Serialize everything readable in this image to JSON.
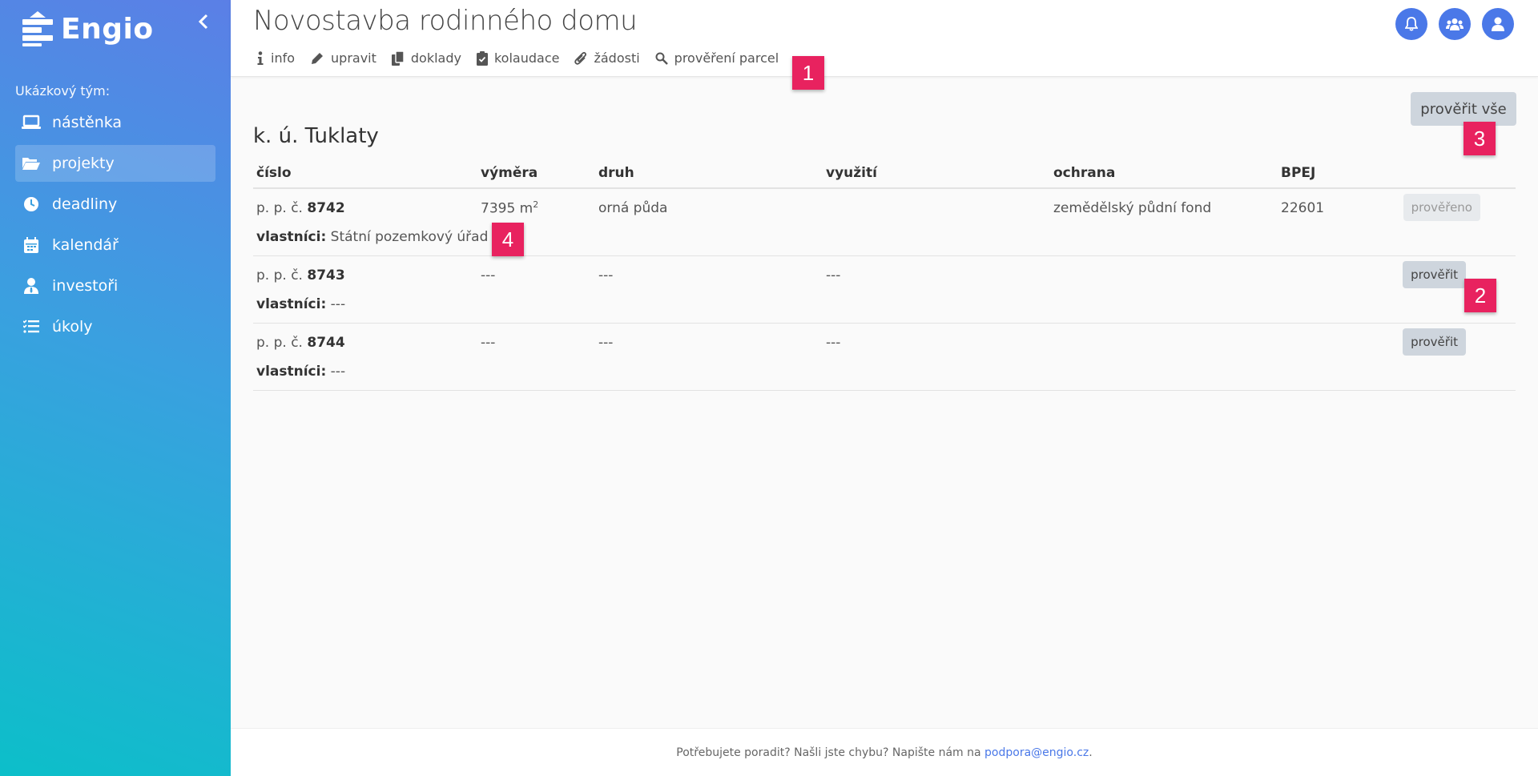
{
  "sidebar": {
    "logo_text": "Engio",
    "team_label": "Ukázkový tým:",
    "items": [
      {
        "label": "nástěnka",
        "icon": "laptop-icon"
      },
      {
        "label": "projekty",
        "icon": "folder-open-icon",
        "active": true
      },
      {
        "label": "deadliny",
        "icon": "clock-icon"
      },
      {
        "label": "kalendář",
        "icon": "calendar-icon"
      },
      {
        "label": "investoři",
        "icon": "user-tie-icon"
      },
      {
        "label": "úkoly",
        "icon": "tasks-icon"
      }
    ]
  },
  "header": {
    "title": "Novostavba rodinného domu",
    "tabs": [
      {
        "label": "info",
        "icon": "info-icon"
      },
      {
        "label": "upravit",
        "icon": "pencil-icon"
      },
      {
        "label": "doklady",
        "icon": "copy-icon"
      },
      {
        "label": "kolaudace",
        "icon": "clipboard-check-icon"
      },
      {
        "label": "žádosti",
        "icon": "paperclip-icon"
      },
      {
        "label": "prověření parcel",
        "icon": "search-icon"
      }
    ],
    "buttons": [
      "bell-icon",
      "users-icon",
      "user-icon"
    ]
  },
  "main": {
    "verify_all": "prověřit vše",
    "section_title": "k. ú. Tuklaty",
    "columns": [
      "číslo",
      "výměra",
      "druh",
      "využití",
      "ochrana",
      "BPEJ"
    ],
    "owners_label": "vlastníci:",
    "parcel_prefix": "p. p. č.",
    "rows": [
      {
        "number": "8742",
        "area": "7395 m",
        "area_sup": "2",
        "type": "orná půda",
        "use": "",
        "protection": "zemědělský půdní fond",
        "bpej": "22601",
        "owners": "Státní pozemkový úřad",
        "button": "prověřeno",
        "disabled": true
      },
      {
        "number": "8743",
        "area": "---",
        "area_sup": "",
        "type": "---",
        "use": "---",
        "protection": "",
        "bpej": "",
        "owners": "---",
        "button": "prověřit",
        "disabled": false
      },
      {
        "number": "8744",
        "area": "---",
        "area_sup": "",
        "type": "---",
        "use": "---",
        "protection": "",
        "bpej": "",
        "owners": "---",
        "button": "prověřit",
        "disabled": false
      }
    ]
  },
  "footer": {
    "text": "Potřebujete poradit? Našli jste chybu? Napište nám na ",
    "email": "podpora@engio.cz",
    "end": "."
  },
  "badges": [
    "1",
    "2",
    "3",
    "4"
  ],
  "colors": {
    "accent": "#4a78e8",
    "badge": "#e8225f",
    "button": "#ced5dd"
  }
}
